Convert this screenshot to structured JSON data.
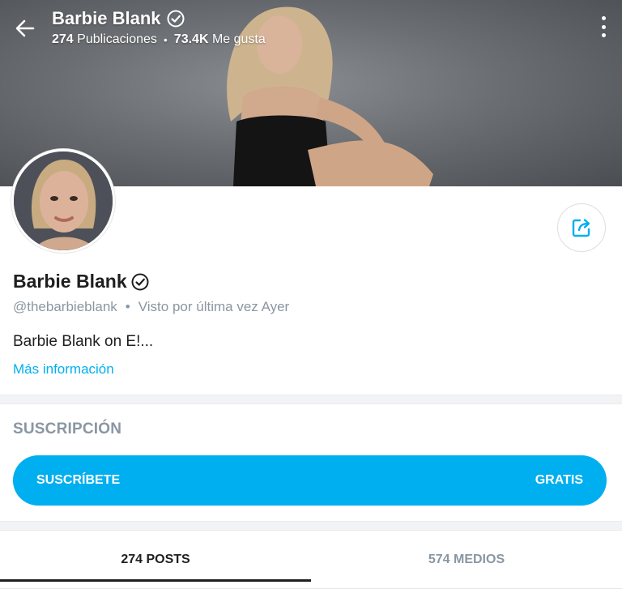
{
  "header": {
    "title": "Barbie Blank",
    "posts_count": "274",
    "posts_label": "Publicaciones",
    "separator": "•",
    "likes_count": "73.4K",
    "likes_label": "Me gusta"
  },
  "profile": {
    "name": "Barbie Blank",
    "handle": "@thebarbieblank",
    "meta_separator": "•",
    "last_seen": "Visto por última vez Ayer",
    "bio": "Barbie Blank on E!...",
    "more_info": "Más información"
  },
  "subscription": {
    "heading": "SUSCRIPCIÓN",
    "button_label": "SUSCRÍBETE",
    "price_label": "GRATIS"
  },
  "tabs": [
    {
      "label": "274 POSTS",
      "active": true
    },
    {
      "label": "574 MEDIOS",
      "active": false
    }
  ],
  "colors": {
    "accent": "#00aff0",
    "muted_text": "#8a96a3"
  },
  "icons": {
    "back": "arrow-left-icon",
    "more": "more-vertical-icon",
    "verified": "verified-badge-icon",
    "share": "share-icon"
  }
}
